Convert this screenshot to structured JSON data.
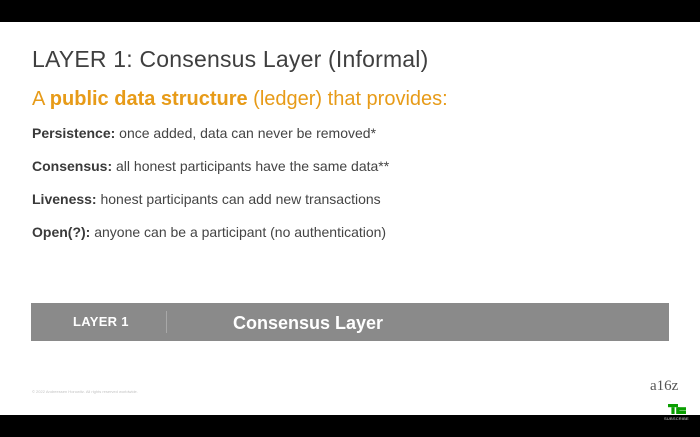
{
  "slide": {
    "title": "LAYER 1: Consensus Layer (Informal)",
    "subtitle": {
      "prefix": "A ",
      "emphasis": "public data structure",
      "suffix": " (ledger) that provides:"
    },
    "bullets": [
      {
        "term": "Persistence:",
        "text": " once added, data can never be removed*"
      },
      {
        "term": "Consensus:",
        "text": " all honest participants have the same data**"
      },
      {
        "term": "Liveness:",
        "text": " honest participants can add new transactions"
      },
      {
        "term": "Open(?):",
        "text": " anyone can be a participant (no authentication)"
      }
    ],
    "layer_bar": {
      "number_label": "LAYER 1",
      "name": "Consensus Layer"
    },
    "footer": {
      "copyright": "© 2022 Andreessen Horowitz. All rights reserved worldwide.",
      "logo": "a16z"
    }
  },
  "overlay": {
    "badge": "TC",
    "subscribe_label": "SUBSCRIBE"
  },
  "colors": {
    "accent": "#e79b18",
    "bar": "#8a8a8a",
    "badge_green": "#0a9e01"
  }
}
